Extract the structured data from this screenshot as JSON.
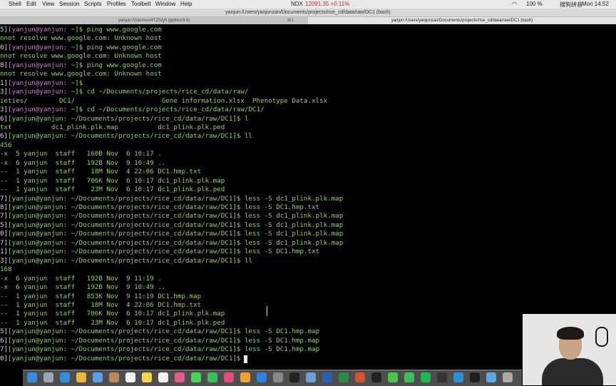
{
  "menubar": {
    "items": [
      "Shell",
      "Edit",
      "View",
      "Session",
      "Scripts",
      "Profiles",
      "Toolbelt",
      "Window",
      "Help"
    ],
    "stock_label": "NDX",
    "stock_value": "12091.35 +0.11%",
    "battery": "100 %",
    "input_method": "搜狗拼音",
    "clock": "Mon 14:52"
  },
  "window": {
    "title": "yanjun:/Users/yanjunzan/Documents/projects/rice_cd/data/raw/DC1 (bash)"
  },
  "tabs": [
    {
      "label": "yanjun:/Volumes/4TZS/yh (python3.6)",
      "number": "⌘1"
    },
    {
      "label": "yanjun:/Users/yanjunzan/Documents/projects/rice_cd/data/raw/DC1 (bash)",
      "number": ""
    }
  ],
  "terminal": {
    "lines": [
      [
        {
          "t": "5]",
          "c": "w"
        },
        {
          "t": "[yanjun@yanjun: ",
          "c": "m"
        },
        {
          "t": "~",
          "c": "g"
        },
        {
          "t": "]$ ping www.google.com",
          "c": "g"
        }
      ],
      [
        {
          "t": "nnot resolve www.google.com: Unknown host",
          "c": "g"
        }
      ],
      [
        {
          "t": "0]",
          "c": "w"
        },
        {
          "t": "[yanjun@yanjun: ",
          "c": "m"
        },
        {
          "t": "~",
          "c": "g"
        },
        {
          "t": "]$ ping www.google.com",
          "c": "g"
        }
      ],
      [
        {
          "t": "nnot resolve www.google.com: Unknown host",
          "c": "g"
        }
      ],
      [
        {
          "t": "8]",
          "c": "w"
        },
        {
          "t": "[yanjun@yanjun: ",
          "c": "m"
        },
        {
          "t": "~",
          "c": "g"
        },
        {
          "t": "]$ ping www.google.com",
          "c": "g"
        }
      ],
      [
        {
          "t": "nnot resolve www.google.com: Unknown host",
          "c": "g"
        }
      ],
      [
        {
          "t": "1]",
          "c": "w"
        },
        {
          "t": "[yanjun@yanjun: ",
          "c": "m"
        },
        {
          "t": "~",
          "c": "g"
        },
        {
          "t": "]$",
          "c": "g"
        }
      ],
      [
        {
          "t": "3]",
          "c": "w"
        },
        {
          "t": "[yanjun@yanjun: ",
          "c": "m"
        },
        {
          "t": "~",
          "c": "g"
        },
        {
          "t": "]$ cd ~/Documents/projects/rice_cd/data/raw/",
          "c": "g"
        }
      ],
      [
        {
          "t": "ieties/        DC1/                      Gene information.xlsx  Phenotype Data.xlsx",
          "c": "g"
        }
      ],
      [
        {
          "t": "3]",
          "c": "w"
        },
        {
          "t": "[yanjun@yanjun: ",
          "c": "m"
        },
        {
          "t": "~",
          "c": "g"
        },
        {
          "t": "]$ cd ~/Documents/projects/rice_cd/data/raw/DC1/",
          "c": "g"
        }
      ],
      [
        {
          "t": "6]",
          "c": "w"
        },
        {
          "t": "[yanjun@yanjun: ~/Documents/projects/rice_cd/data/raw/DC1]$ l",
          "c": "g"
        }
      ],
      [
        {
          "t": "txt          dc1_plink.plk.map          dc1_plink.plk.ped",
          "c": "g"
        }
      ],
      [
        {
          "t": "6]",
          "c": "w"
        },
        {
          "t": "[yanjun@yanjun: ~/Documents/projects/rice_cd/data/raw/DC1]$ ll",
          "c": "g"
        }
      ],
      [
        {
          "t": "456",
          "c": "g"
        }
      ],
      [
        {
          "t": "-x  5 yanjun  staff   160B Nov  6 10:17 .",
          "c": "g"
        }
      ],
      [
        {
          "t": "-x  6 yanjun  staff   192B Nov  9 10:49 ..",
          "c": "g"
        }
      ],
      [
        {
          "t": "--  1 yanjun  staff    18M Nov  4 22:06 DC1.hmp.txt",
          "c": "g"
        }
      ],
      [
        {
          "t": "--  1 yanjun  staff   706K Nov  6 10:17 dc1_plink.plk.map",
          "c": "g"
        }
      ],
      [
        {
          "t": "--  1 yanjun  staff    23M Nov  6 10:17 dc1_plink.plk.ped",
          "c": "g"
        }
      ],
      [
        {
          "t": "7]",
          "c": "w"
        },
        {
          "t": "[yanjun@yanjun: ~/Documents/projects/rice_cd/data/raw/DC1]$ less -S dc1_plink.plk.map",
          "c": "g"
        }
      ],
      [
        {
          "t": "8]",
          "c": "w"
        },
        {
          "t": "[yanjun@yanjun: ~/Documents/projects/rice_cd/data/raw/DC1]$ less -S DC1.hmp.txt",
          "c": "g"
        }
      ],
      [
        {
          "t": "7]",
          "c": "w"
        },
        {
          "t": "[yanjun@yanjun: ~/Documents/projects/rice_cd/data/raw/DC1]$ less -S dc1_plink.plk.map",
          "c": "g"
        }
      ],
      [
        {
          "t": "5]",
          "c": "w"
        },
        {
          "t": "[yanjun@yanjun: ~/Documents/projects/rice_cd/data/raw/DC1]$ less -S dc1_plink.plk.map",
          "c": "g"
        }
      ],
      [
        {
          "t": "0]",
          "c": "w"
        },
        {
          "t": "[yanjun@yanjun: ~/Documents/projects/rice_cd/data/raw/DC1]$ less -S dc1_plink.plk.map",
          "c": "g"
        }
      ],
      [
        {
          "t": "7]",
          "c": "w"
        },
        {
          "t": "[yanjun@yanjun: ~/Documents/projects/rice_cd/data/raw/DC1]$ less -S dc1_plink.plk.map",
          "c": "g"
        }
      ],
      [
        {
          "t": "1]",
          "c": "w"
        },
        {
          "t": "[yanjun@yanjun: ~/Documents/projects/rice_cd/data/raw/DC1]$ less -S DC1.hmp.txt",
          "c": "g"
        }
      ],
      [
        {
          "t": "3]",
          "c": "w"
        },
        {
          "t": "[yanjun@yanjun: ~/Documents/projects/rice_cd/data/raw/DC1]$ ll",
          "c": "g"
        }
      ],
      [
        {
          "t": "168",
          "c": "g"
        }
      ],
      [
        {
          "t": "-x  6 yanjun  staff   192B Nov  9 11:19 .",
          "c": "g"
        }
      ],
      [
        {
          "t": "-x  6 yanjun  staff   192B Nov  9 10:49 ..",
          "c": "g"
        }
      ],
      [
        {
          "t": "--  1 yanjun  staff   853K Nov  9 11:19 DC1.hmp.map",
          "c": "g"
        }
      ],
      [
        {
          "t": "--  1 yanjun  staff    18M Nov  4 22:06 DC1.hmp.txt",
          "c": "g"
        }
      ],
      [
        {
          "t": "--  1 yanjun  staff   706K Nov  6 10:17 dc1_plink.plk.map",
          "c": "g"
        }
      ],
      [
        {
          "t": "--  1 yanjun  staff    23M Nov  6 10:17 dc1_plink.plk.ped",
          "c": "g"
        }
      ],
      [
        {
          "t": "5]",
          "c": "w"
        },
        {
          "t": "[yanjun@yanjun: ~/Documents/projects/rice_cd/data/raw/DC1]$ less -S DC1.hmp.map",
          "c": "g"
        }
      ],
      [
        {
          "t": "6]",
          "c": "w"
        },
        {
          "t": "[yanjun@yanjun: ~/Documents/projects/rice_cd/data/raw/DC1]$ less -S DC1.hmp.map",
          "c": "g"
        }
      ],
      [
        {
          "t": "7]",
          "c": "w"
        },
        {
          "t": "[yanjun@yanjun: ~/Documents/projects/rice_cd/data/raw/DC1]$ less -S DC1.hmp.map",
          "c": "g"
        }
      ],
      [
        {
          "t": "0]",
          "c": "w"
        },
        {
          "t": "[yanjun@yanjun: ~/Documents/projects/rice_cd/data/raw/DC1]$ ",
          "c": "g"
        }
      ]
    ]
  },
  "dock": {
    "icons": [
      "finder-icon",
      "launchpad-icon",
      "safari-icon",
      "chrome-icon",
      "mail-icon",
      "contacts-icon",
      "calendar-icon",
      "notes-icon",
      "reminders-icon",
      "photos-icon",
      "messages-icon",
      "facetime-icon",
      "itunes-icon",
      "ibooks-icon",
      "appstore-icon",
      "preferences-icon",
      "terminal-icon",
      "rstudio-icon",
      "word-icon",
      "excel-icon",
      "powerpoint-icon",
      "qq-icon",
      "wechat-icon",
      "evernote-icon",
      "spotify-icon",
      "github-icon",
      "vscode-icon",
      "iterm-icon",
      "preview-icon",
      "trash-icon"
    ],
    "colors": [
      "#3d8be0",
      "#9aa4b4",
      "#2f8fd8",
      "#e8b93a",
      "#5b9de8",
      "#b98a5e",
      "#f2f2f2",
      "#f4d34d",
      "#f2f2f2",
      "#e25c8c",
      "#4bd45a",
      "#3ac05a",
      "#e24d7a",
      "#f0a030",
      "#2f7fe8",
      "#8a8a8a",
      "#222222",
      "#6aa0d8",
      "#2b5fb5",
      "#2a8a4a",
      "#d2542e",
      "#222222",
      "#4ec24e",
      "#3fbf5f",
      "#1db954",
      "#333333",
      "#2b8fd6",
      "#1e1e1e",
      "#5fa8e8",
      "#aaaaaa"
    ]
  }
}
